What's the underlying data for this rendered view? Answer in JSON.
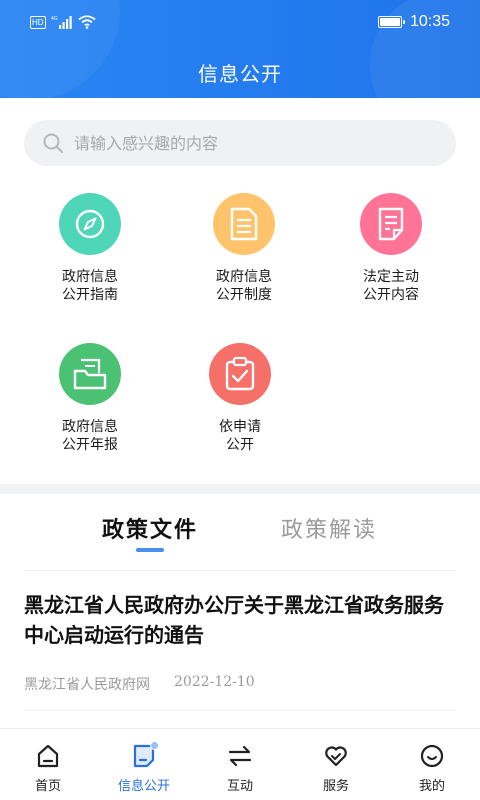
{
  "status_bar": {
    "network": "HD",
    "time": "10:35"
  },
  "header": {
    "title": "信息公开"
  },
  "search": {
    "placeholder": "请输入感兴趣的内容"
  },
  "grid": [
    {
      "label": "政府信息\n公开指南",
      "icon": "compass-icon",
      "color": "#4fd6b9"
    },
    {
      "label": "政府信息\n公开制度",
      "icon": "document-icon",
      "color": "#ffc46b"
    },
    {
      "label": "法定主动\n公开内容",
      "icon": "note-icon",
      "color": "#ff7396"
    },
    {
      "label": "政府信息\n公开年报",
      "icon": "folder-icon",
      "color": "#4bc173"
    },
    {
      "label": "依申请\n公开",
      "icon": "clipboard-check-icon",
      "color": "#f57069"
    }
  ],
  "tabs": [
    {
      "label": "政策文件",
      "active": true
    },
    {
      "label": "政策解读",
      "active": false
    }
  ],
  "article": {
    "title": "黑龙江省人民政府办公厅关于黑龙江省政务服务中心启动运行的通告",
    "source": "黑龙江省人民政府网",
    "date": "2022-12-10"
  },
  "nav": [
    {
      "label": "首页",
      "icon": "home-icon",
      "active": false
    },
    {
      "label": "信息公开",
      "icon": "info-doc-icon",
      "active": true
    },
    {
      "label": "互动",
      "icon": "exchange-icon",
      "active": false
    },
    {
      "label": "服务",
      "icon": "heart-icon",
      "active": false
    },
    {
      "label": "我的",
      "icon": "profile-icon",
      "active": false
    }
  ],
  "colors": {
    "primary": "#2a86f3",
    "nav_active": "#2a6fdb",
    "tab_underline": "#4a8ff0"
  }
}
